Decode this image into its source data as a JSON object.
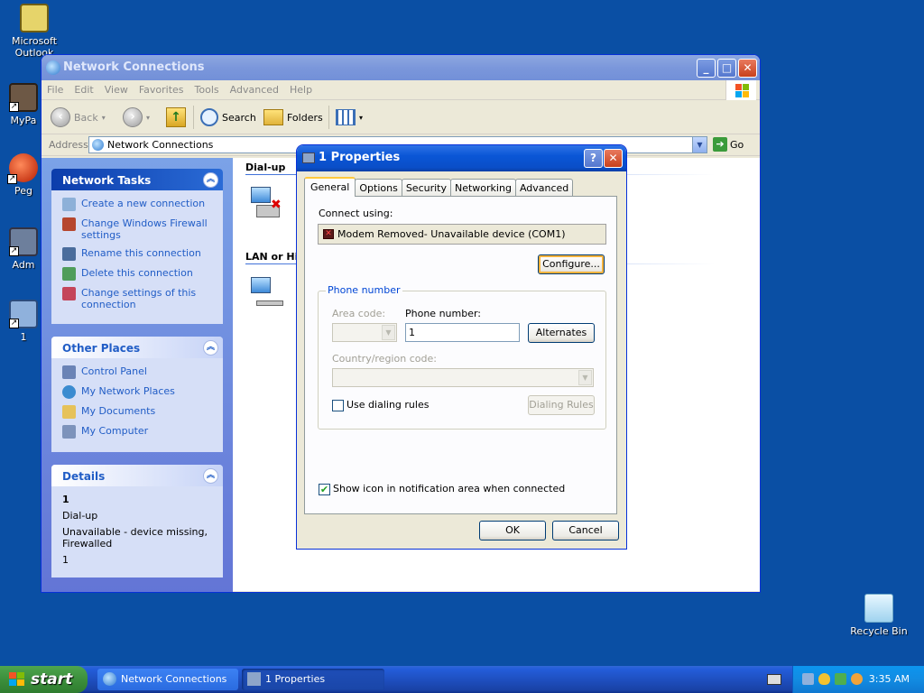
{
  "desktop": {
    "icons": [
      {
        "label": "Microsoft Outlook"
      },
      {
        "label": "MyPa"
      },
      {
        "label": "Peg"
      },
      {
        "label": "Adm"
      },
      {
        "label": "1"
      },
      {
        "label": "Recycle Bin"
      }
    ]
  },
  "window": {
    "title": "Network Connections",
    "menu": [
      "File",
      "Edit",
      "View",
      "Favorites",
      "Tools",
      "Advanced",
      "Help"
    ],
    "toolbar": {
      "back": "Back",
      "search": "Search",
      "folders": "Folders"
    },
    "address": {
      "label": "Address",
      "value": "Network Connections",
      "go": "Go"
    },
    "network_tasks": {
      "title": "Network Tasks",
      "items": [
        "Create a new connection",
        "Change Windows Firewall settings",
        "Rename this connection",
        "Delete this connection",
        "Change settings of this connection"
      ]
    },
    "other_places": {
      "title": "Other Places",
      "items": [
        "Control Panel",
        "My Network Places",
        "My Documents",
        "My Computer"
      ]
    },
    "details": {
      "title": "Details",
      "name": "1",
      "type": "Dial-up",
      "status": "Unavailable - device missing, Firewalled",
      "extra": "1"
    },
    "groups": {
      "dialup": "Dial-up",
      "lan": "LAN or Hig"
    }
  },
  "dialog": {
    "title": "1 Properties",
    "tabs": [
      "General",
      "Options",
      "Security",
      "Networking",
      "Advanced"
    ],
    "connect_using_label": "Connect using:",
    "device": "Modem Removed- Unavailable device (COM1)",
    "configure_button": "Configure...",
    "phone_number_legend": "Phone number",
    "area_code_label": "Area code:",
    "phone_number_label": "Phone number:",
    "phone_number_value": "1",
    "alternates_button": "Alternates",
    "country_label": "Country/region code:",
    "use_dialing_rules": "Use dialing rules",
    "dialing_rules_button": "Dialing Rules",
    "show_icon_label": "Show icon in notification area when connected",
    "show_icon_checked": true,
    "ok": "OK",
    "cancel": "Cancel"
  },
  "taskbar": {
    "start": "start",
    "buttons": [
      "Network Connections",
      "1 Properties"
    ],
    "clock": "3:35 AM"
  }
}
